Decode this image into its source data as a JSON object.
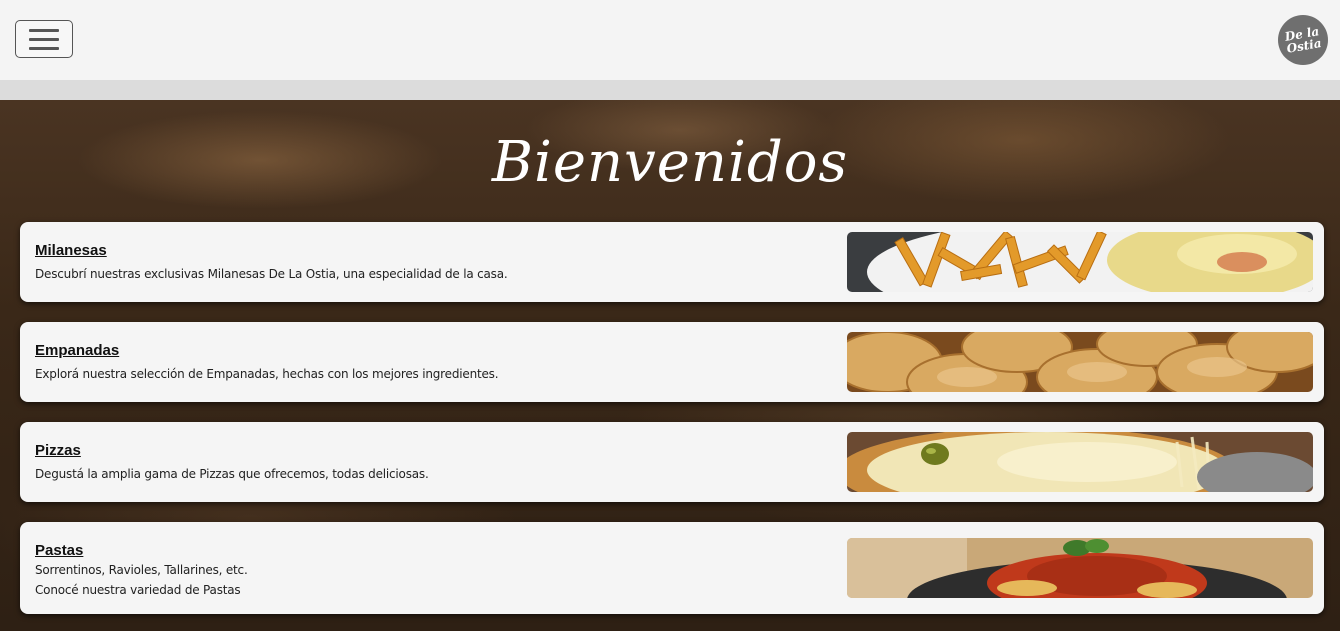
{
  "header": {
    "menu_icon": "hamburger-menu-icon",
    "logo_text": "De la Ostia",
    "logo_color": "#6f6f6f"
  },
  "hero": {
    "title": "Bienvenidos"
  },
  "categories": [
    {
      "title": "Milanesas",
      "lines": [
        "Descubrí nuestras exclusivas Milanesas De La Ostia, una especialidad de la casa."
      ],
      "image": "milanesa-photo"
    },
    {
      "title": "Empanadas",
      "lines": [
        "Explorá nuestra selección de Empanadas, hechas con los mejores ingredientes."
      ],
      "image": "empanadas-photo"
    },
    {
      "title": "Pizzas",
      "lines": [
        "Degustá la amplia gama de Pizzas que ofrecemos, todas deliciosas."
      ],
      "image": "pizza-photo"
    },
    {
      "title": "Pastas",
      "lines": [
        "Sorrentinos, Ravioles, Tallarines, etc.",
        "Conocé nuestra variedad de Pastas"
      ],
      "image": "pasta-photo"
    }
  ],
  "colors": {
    "header_bg": "#f4f4f4",
    "stripe": "#dcdcdc",
    "card_bg": "#f5f5f5",
    "hero_bg": "#3a2818"
  }
}
